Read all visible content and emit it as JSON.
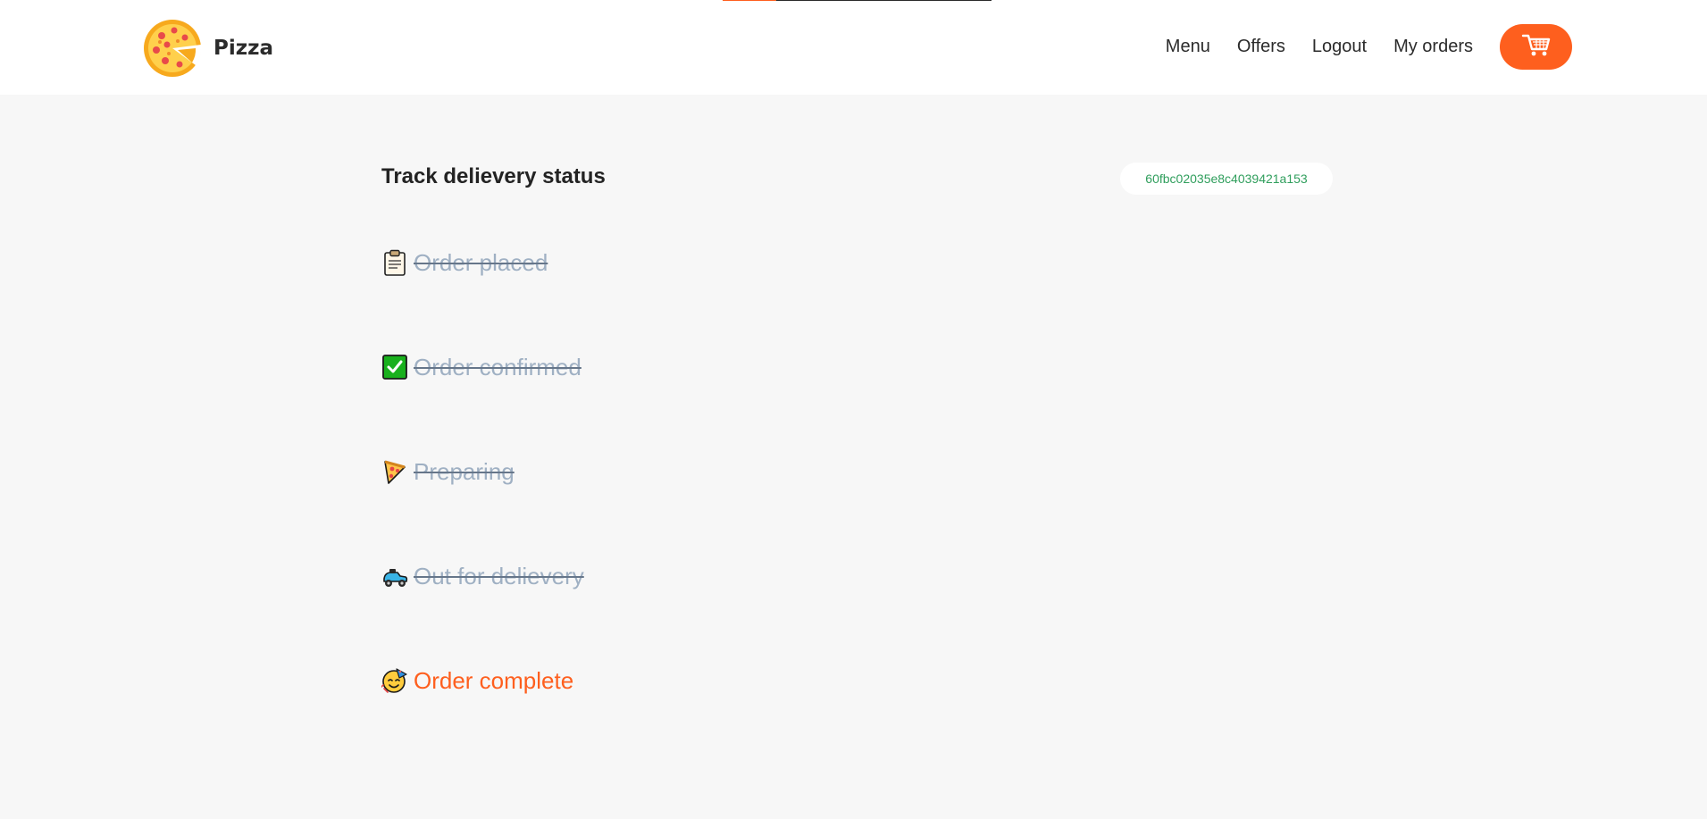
{
  "app": {
    "brand_name": "Pizza",
    "logo_icon": "pizza-logo-icon"
  },
  "nav": {
    "links": [
      {
        "label": "Menu"
      },
      {
        "label": "Offers"
      },
      {
        "label": "Logout"
      },
      {
        "label": "My orders"
      }
    ],
    "cart_icon": "cart-icon"
  },
  "loading_progress": 0.2,
  "status_page": {
    "title": "Track delievery status",
    "order_id": "60fbc02035e8c4039421a153",
    "steps": [
      {
        "label": "Order placed",
        "icon": "clipboard-icon",
        "state": "done"
      },
      {
        "label": "Order confirmed",
        "icon": "check-box-icon",
        "state": "done"
      },
      {
        "label": "Preparing",
        "icon": "pizza-slice-icon",
        "state": "done"
      },
      {
        "label": "Out for delievery",
        "icon": "scooter-icon",
        "state": "done"
      },
      {
        "label": "Order complete",
        "icon": "party-face-icon",
        "state": "current"
      }
    ]
  },
  "colors": {
    "accent": "#fe5f1e",
    "done_text": "#9fb0c3",
    "order_id_text": "#2f9e5c",
    "page_background": "#f7f7f7"
  }
}
